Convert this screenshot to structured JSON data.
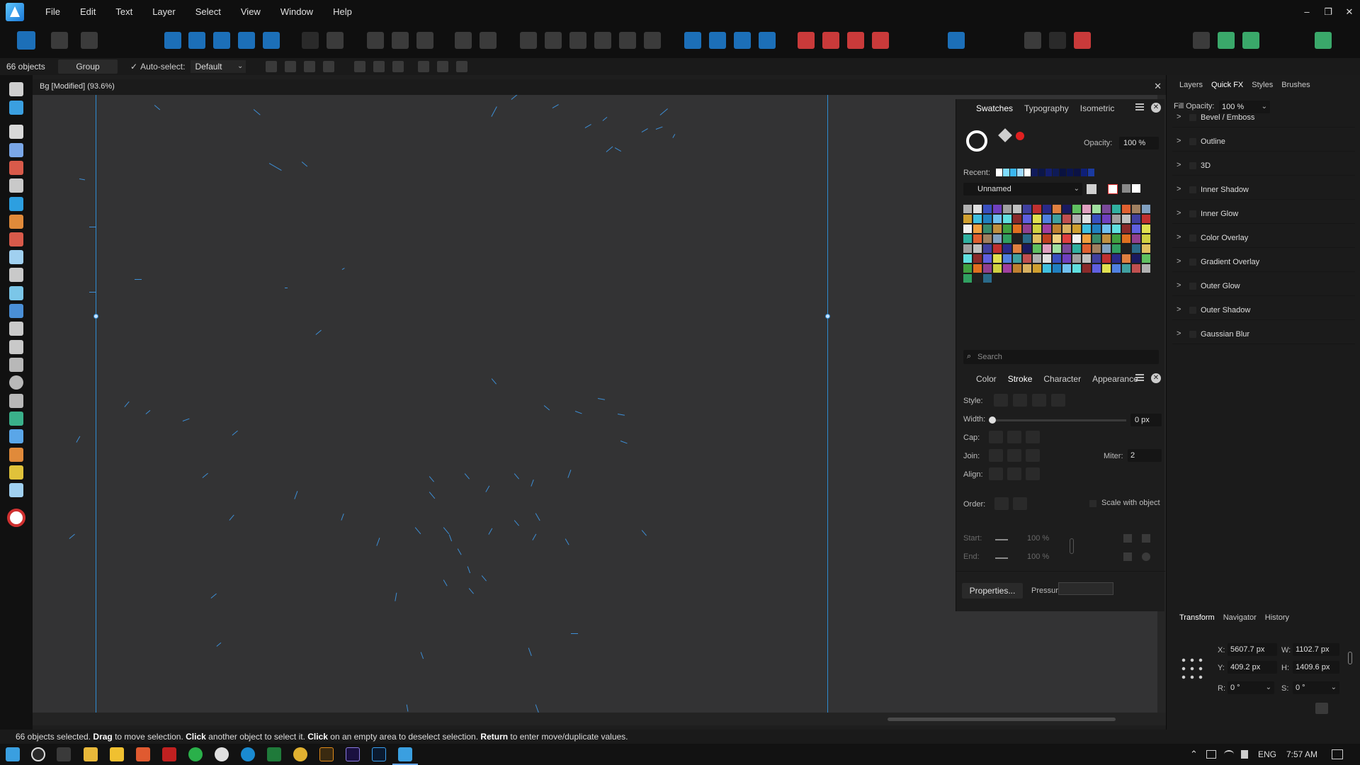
{
  "menubar": {
    "items": [
      "File",
      "Edit",
      "Text",
      "Layer",
      "Select",
      "View",
      "Window",
      "Help"
    ],
    "window_controls": [
      "–",
      "❐",
      "✕"
    ]
  },
  "context": {
    "object_count": "66 objects",
    "group_label": "Group",
    "autoselect_label": "Auto-select:",
    "autoselect_value": "Default"
  },
  "document": {
    "title": "Bg [Modified] (93.6%)",
    "close": "✕"
  },
  "swatches_panel": {
    "tabs": [
      "Swatches",
      "Typography",
      "Isometric"
    ],
    "opacity_label": "Opacity:",
    "opacity_value": "100 %",
    "recent_label": "Recent:",
    "palette_name": "Unnamed",
    "search_placeholder": "Search",
    "recent_colors": [
      "#ffffff",
      "#7fdcff",
      "#3bb6f0",
      "#9fd8ff",
      "#ffffff",
      "#101a5a",
      "#0c1648",
      "#131e6e",
      "#0e1a56",
      "#0a1240",
      "#0a1550",
      "#0b1244",
      "#0e1f78",
      "#1a3aa0"
    ]
  },
  "stroke_panel": {
    "tabs": [
      "Color",
      "Stroke",
      "Character",
      "Appearance"
    ],
    "style_label": "Style:",
    "width_label": "Width:",
    "width_value": "0 px",
    "cap_label": "Cap:",
    "join_label": "Join:",
    "miter_label": "Miter:",
    "miter_value": "2",
    "align_label": "Align:",
    "order_label": "Order:",
    "scale_label": "Scale with object",
    "start_label": "Start:",
    "end_label": "End:",
    "start_pct": "100 %",
    "end_pct": "100 %",
    "properties_label": "Properties...",
    "pressure_label": "Pressure:"
  },
  "studio": {
    "tabs": [
      "Layers",
      "Quick FX",
      "Styles",
      "Brushes"
    ],
    "fill_opacity_label": "Fill Opacity:",
    "fill_opacity_value": "100 %",
    "effects": [
      "Bevel / Emboss",
      "Outline",
      "3D",
      "Inner Shadow",
      "Inner Glow",
      "Color Overlay",
      "Gradient Overlay",
      "Outer Glow",
      "Outer Shadow",
      "Gaussian Blur"
    ]
  },
  "transform": {
    "tabs": [
      "Transform",
      "Navigator",
      "History"
    ],
    "x_label": "X:",
    "x_value": "5607.7 px",
    "y_label": "Y:",
    "y_value": "409.2 px",
    "w_label": "W:",
    "w_value": "1102.7 px",
    "h_label": "H:",
    "h_value": "1409.6 px",
    "r_label": "R:",
    "r_value": "0 °",
    "s_label": "S:",
    "s_value": "0 °"
  },
  "status": {
    "p1": "66 objects selected. ",
    "b1": "Drag",
    "p2": " to move selection. ",
    "b2": "Click",
    "p3": " another object to select it. ",
    "b3": "Click",
    "p4": " on an empty area to deselect selection. ",
    "b4": "Return",
    "p5": " to enter move/duplicate values."
  },
  "tray": {
    "language": "ENG",
    "time": "7:57 AM"
  }
}
